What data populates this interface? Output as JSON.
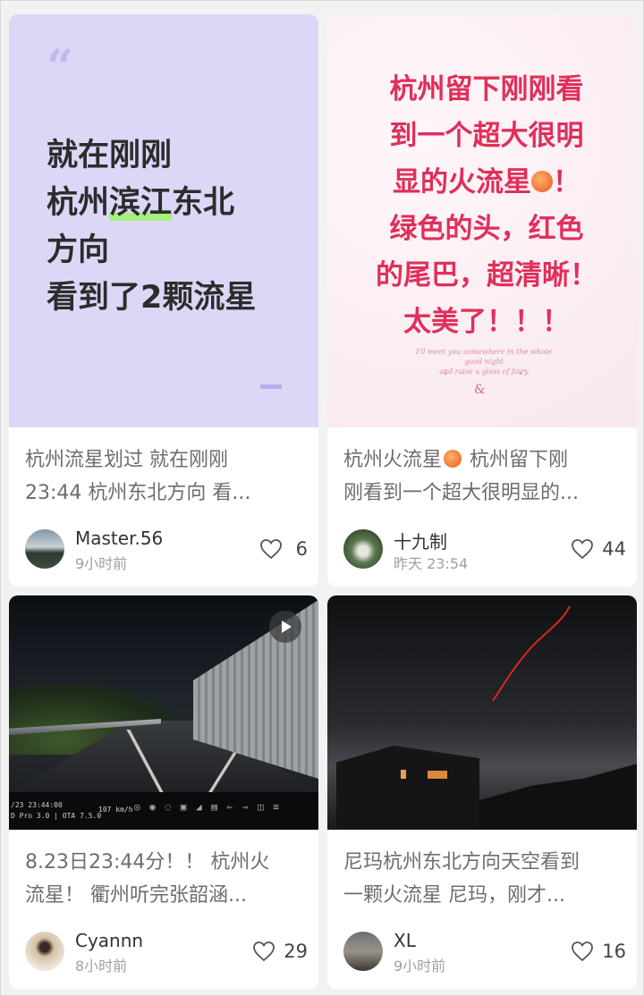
{
  "cards": [
    {
      "cover_lines": [
        "就在刚刚",
        "杭州",
        "滨江",
        "东北",
        "方向",
        "看到了2颗流星"
      ],
      "quote_mark": "“",
      "desc_lines": [
        "杭州流星划过 就在刚刚",
        "23:44 杭州东北方向 看..."
      ],
      "author": "Master.56",
      "time": "9小时前",
      "likes": "6"
    },
    {
      "cover_lines": [
        "杭州留下刚刚看",
        "到一个超大很明",
        "显的火流星",
        "！",
        "绿色的头，红色",
        "的尾巴，超清晰！",
        "太美了！！！"
      ],
      "script_line1": "I'll meet you somewhere in the whole good night",
      "script_line2": "and raise a glass of fairy",
      "script_dots": "• · · · · · · · · •",
      "script_amp": "&",
      "desc_lines": [
        "杭州火流星",
        " 杭州留下刚",
        "刚看到一个超大很明显的..."
      ],
      "author": "十九制",
      "time": "昨天 23:54",
      "likes": "44"
    },
    {
      "hud_line1": "/23    23:44:00",
      "hud_line2": "D Pro  3.0 | OTA 7.5.0",
      "hud_speed": "107 km/h",
      "hud_icons": "◎ ◉ ◌ ▣ ◢ ▤ ⇐ ⇒ ◫ ≡",
      "desc_lines": [
        "8.23日23:44分！！ 杭州火",
        "流星！ 衢州听完张韶涵..."
      ],
      "author": "Cyannn",
      "time": "8小时前",
      "likes": "29"
    },
    {
      "desc_lines": [
        "尼玛杭州东北方向天空看到",
        "一颗火流星 尼玛，刚才..."
      ],
      "author": "XL",
      "time": "9小时前",
      "likes": "16"
    }
  ],
  "colors": {
    "accent_pink": "#e02f5b",
    "lavender": "#dcd7f7",
    "highlight_green": "#a7ee7c"
  },
  "icons": {
    "like": "heart-outline-icon",
    "video": "play-icon"
  }
}
